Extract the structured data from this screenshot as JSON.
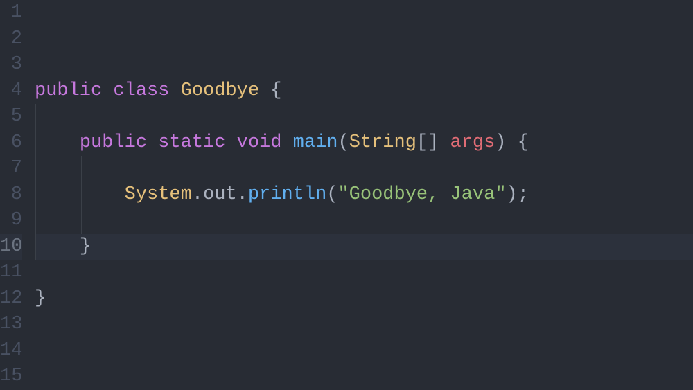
{
  "editor": {
    "lineCount": 15,
    "activeLine": 10,
    "lines": {
      "4": [
        {
          "cls": "tok-keyword",
          "text": "public"
        },
        {
          "cls": "tok-punct",
          "text": " "
        },
        {
          "cls": "tok-keyword",
          "text": "class"
        },
        {
          "cls": "tok-punct",
          "text": " "
        },
        {
          "cls": "tok-class",
          "text": "Goodbye"
        },
        {
          "cls": "tok-punct",
          "text": " {"
        }
      ],
      "6": [
        {
          "cls": "tok-punct",
          "text": "    "
        },
        {
          "cls": "tok-keyword",
          "text": "public"
        },
        {
          "cls": "tok-punct",
          "text": " "
        },
        {
          "cls": "tok-keyword",
          "text": "static"
        },
        {
          "cls": "tok-punct",
          "text": " "
        },
        {
          "cls": "tok-keyword",
          "text": "void"
        },
        {
          "cls": "tok-punct",
          "text": " "
        },
        {
          "cls": "tok-method",
          "text": "main"
        },
        {
          "cls": "tok-punct",
          "text": "("
        },
        {
          "cls": "tok-type",
          "text": "String"
        },
        {
          "cls": "tok-punct",
          "text": "[] "
        },
        {
          "cls": "tok-var",
          "text": "args"
        },
        {
          "cls": "tok-punct",
          "text": ") {"
        }
      ],
      "8": [
        {
          "cls": "tok-punct",
          "text": "        "
        },
        {
          "cls": "tok-object",
          "text": "System"
        },
        {
          "cls": "tok-punct",
          "text": "."
        },
        {
          "cls": "tok-field",
          "text": "out"
        },
        {
          "cls": "tok-punct",
          "text": "."
        },
        {
          "cls": "tok-method",
          "text": "println"
        },
        {
          "cls": "tok-punct",
          "text": "("
        },
        {
          "cls": "tok-string",
          "text": "\"Goodbye, Java\""
        },
        {
          "cls": "tok-punct",
          "text": ");"
        }
      ],
      "10": [
        {
          "cls": "tok-punct",
          "text": "    }"
        }
      ],
      "12": [
        {
          "cls": "tok-punct",
          "text": "}"
        }
      ]
    },
    "indentGuides": {
      "5": [
        1
      ],
      "6": [
        1
      ],
      "7": [
        1,
        2
      ],
      "8": [
        1,
        2
      ],
      "9": [
        1,
        2
      ],
      "10": [
        1
      ]
    }
  }
}
